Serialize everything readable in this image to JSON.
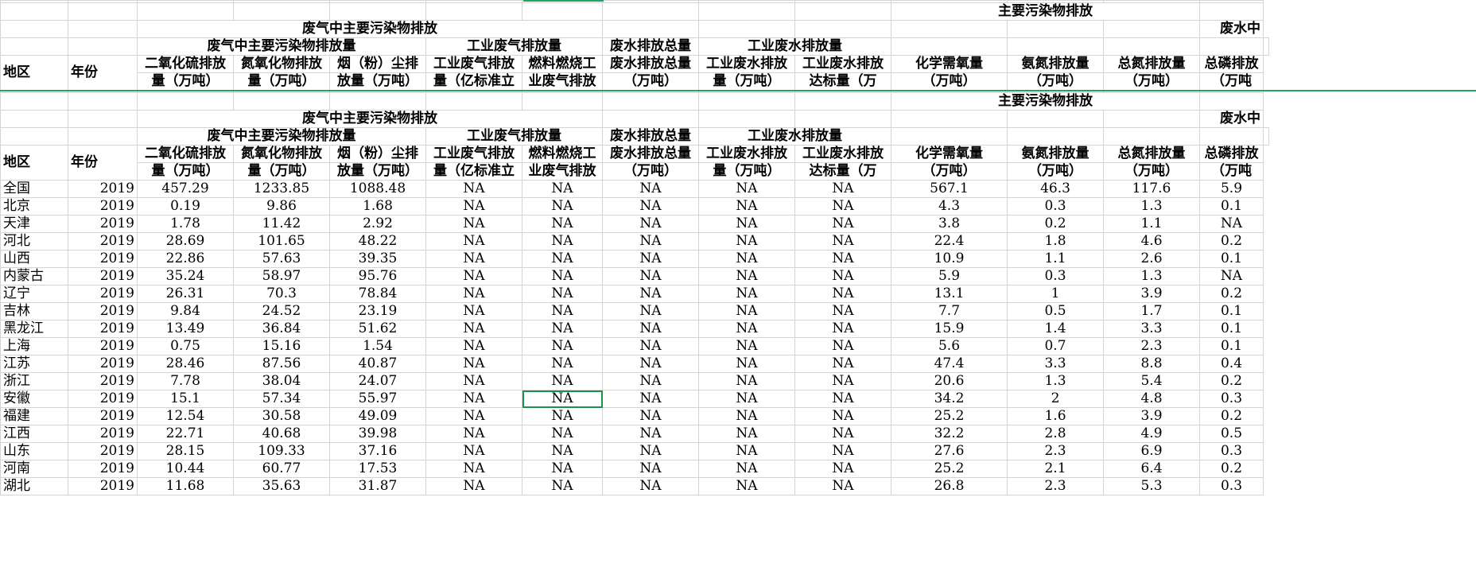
{
  "header": {
    "group_main": "主要污染物排放",
    "group_air": "废气中主要污染物排放",
    "group_water_partial": "废水中",
    "sub_air_pollutants": "废气中主要污染物排放量",
    "sub_industrial_gas": "工业废气排放量",
    "sub_wastewater_total": "废水排放总量",
    "sub_industrial_water": "工业废水排放量",
    "col_region": "地区",
    "col_year": "年份",
    "cols_line1": [
      "二氧化硫排放",
      "氮氧化物排放",
      "烟（粉）尘排",
      "工业废气排放",
      "燃料燃烧工",
      "废水排放总量",
      "工业废水排放",
      "工业废水排放",
      "化学需氧量",
      "氨氮排放量",
      "总氮排放量",
      "总磷排放"
    ],
    "cols_line2": [
      "量（万吨）",
      "量（万吨）",
      "放量（万吨）",
      "量（亿标准立",
      "业废气排放",
      "（万吨）",
      "量（万吨）",
      "达标量（万",
      "（万吨）",
      "（万吨）",
      "（万吨）",
      "（万吨"
    ]
  },
  "rows": [
    [
      "全国",
      "2019",
      "457.29",
      "1233.85",
      "1088.48",
      "NA",
      "NA",
      "NA",
      "NA",
      "NA",
      "567.1",
      "46.3",
      "117.6",
      "5.9"
    ],
    [
      "北京",
      "2019",
      "0.19",
      "9.86",
      "1.68",
      "NA",
      "NA",
      "NA",
      "NA",
      "NA",
      "4.3",
      "0.3",
      "1.3",
      "0.1"
    ],
    [
      "天津",
      "2019",
      "1.78",
      "11.42",
      "2.92",
      "NA",
      "NA",
      "NA",
      "NA",
      "NA",
      "3.8",
      "0.2",
      "1.1",
      "NA"
    ],
    [
      "河北",
      "2019",
      "28.69",
      "101.65",
      "48.22",
      "NA",
      "NA",
      "NA",
      "NA",
      "NA",
      "22.4",
      "1.8",
      "4.6",
      "0.2"
    ],
    [
      "山西",
      "2019",
      "22.86",
      "57.63",
      "39.35",
      "NA",
      "NA",
      "NA",
      "NA",
      "NA",
      "10.9",
      "1.1",
      "2.6",
      "0.1"
    ],
    [
      "内蒙古",
      "2019",
      "35.24",
      "58.97",
      "95.76",
      "NA",
      "NA",
      "NA",
      "NA",
      "NA",
      "5.9",
      "0.3",
      "1.3",
      "NA"
    ],
    [
      "辽宁",
      "2019",
      "26.31",
      "70.3",
      "78.84",
      "NA",
      "NA",
      "NA",
      "NA",
      "NA",
      "13.1",
      "1",
      "3.9",
      "0.2"
    ],
    [
      "吉林",
      "2019",
      "9.84",
      "24.52",
      "23.19",
      "NA",
      "NA",
      "NA",
      "NA",
      "NA",
      "7.7",
      "0.5",
      "1.7",
      "0.1"
    ],
    [
      "黑龙江",
      "2019",
      "13.49",
      "36.84",
      "51.62",
      "NA",
      "NA",
      "NA",
      "NA",
      "NA",
      "15.9",
      "1.4",
      "3.3",
      "0.1"
    ],
    [
      "上海",
      "2019",
      "0.75",
      "15.16",
      "1.54",
      "NA",
      "NA",
      "NA",
      "NA",
      "NA",
      "5.6",
      "0.7",
      "2.3",
      "0.1"
    ],
    [
      "江苏",
      "2019",
      "28.46",
      "87.56",
      "40.87",
      "NA",
      "NA",
      "NA",
      "NA",
      "NA",
      "47.4",
      "3.3",
      "8.8",
      "0.4"
    ],
    [
      "浙江",
      "2019",
      "7.78",
      "38.04",
      "24.07",
      "NA",
      "NA",
      "NA",
      "NA",
      "NA",
      "20.6",
      "1.3",
      "5.4",
      "0.2"
    ],
    [
      "安徽",
      "2019",
      "15.1",
      "57.34",
      "55.97",
      "NA",
      "NA",
      "NA",
      "NA",
      "NA",
      "34.2",
      "2",
      "4.8",
      "0.3"
    ],
    [
      "福建",
      "2019",
      "12.54",
      "30.58",
      "49.09",
      "NA",
      "NA",
      "NA",
      "NA",
      "NA",
      "25.2",
      "1.6",
      "3.9",
      "0.2"
    ],
    [
      "江西",
      "2019",
      "22.71",
      "40.68",
      "39.98",
      "NA",
      "NA",
      "NA",
      "NA",
      "NA",
      "32.2",
      "2.8",
      "4.9",
      "0.5"
    ],
    [
      "山东",
      "2019",
      "28.15",
      "109.33",
      "37.16",
      "NA",
      "NA",
      "NA",
      "NA",
      "NA",
      "27.6",
      "2.3",
      "6.9",
      "0.3"
    ],
    [
      "河南",
      "2019",
      "10.44",
      "60.77",
      "17.53",
      "NA",
      "NA",
      "NA",
      "NA",
      "NA",
      "25.2",
      "2.1",
      "6.4",
      "0.2"
    ],
    [
      "湖北",
      "2019",
      "11.68",
      "35.63",
      "31.87",
      "NA",
      "NA",
      "NA",
      "NA",
      "NA",
      "26.8",
      "2.3",
      "5.3",
      "0.3"
    ]
  ],
  "selection": {
    "row": 12,
    "col": 6
  },
  "colors": {
    "accent": "#21a366",
    "grid": "#d4d4d4"
  }
}
